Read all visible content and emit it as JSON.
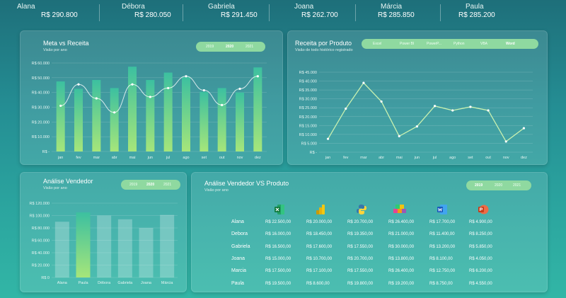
{
  "kpis": [
    {
      "name": "Alana",
      "value": "R$ 290.800"
    },
    {
      "name": "Débora",
      "value": "R$ 280.050"
    },
    {
      "name": "Gabriela",
      "value": "R$ 291.450"
    },
    {
      "name": "Joana",
      "value": "R$ 262.700"
    },
    {
      "name": "Márcia",
      "value": "R$ 285.850"
    },
    {
      "name": "Paula",
      "value": "R$ 285.200"
    }
  ],
  "meta": {
    "title": "Meta vs Receita",
    "subtitle": "Visão por ano",
    "years": [
      "2019",
      "2020",
      "2021"
    ],
    "active_year": "2020"
  },
  "receita": {
    "title": "Receita por Produto",
    "subtitle": "Visão de todo histórico registrado",
    "products": [
      "Excel",
      "Power BI",
      "PowerP...",
      "Python",
      "VBA",
      "Word"
    ],
    "active_product": "Word"
  },
  "vendedor": {
    "title": "Análise Vendedor",
    "subtitle": "Visão por ano",
    "years": [
      "2019",
      "2020",
      "2021"
    ],
    "active_year": "2020"
  },
  "vxp": {
    "title": "Análise Vendedor VS Produto",
    "subtitle": "Visão por ano",
    "years": [
      "2019",
      "2020",
      "2021"
    ],
    "active_year": "2019",
    "icons": [
      "excel-icon",
      "powerbi-icon",
      "python-icon",
      "powerpivot-icon",
      "word-icon",
      "powerpoint-icon"
    ],
    "rows": [
      {
        "name": "Alana",
        "cells": [
          "R$ 22.500,00",
          "R$ 20.000,00",
          "R$ 20.700,00",
          "R$ 26.400,00",
          "R$ 17.700,00",
          "R$ 4.900,00"
        ]
      },
      {
        "name": "Debora",
        "cells": [
          "R$ 16.000,00",
          "R$ 18.450,00",
          "R$ 19.350,00",
          "R$ 21.000,00",
          "R$ 11.400,00",
          "R$ 8.250,00"
        ]
      },
      {
        "name": "Gabriela",
        "cells": [
          "R$ 16.500,00",
          "R$ 17.600,00",
          "R$ 17.550,00",
          "R$ 30.000,00",
          "R$ 13.200,00",
          "R$ 5.850,00"
        ]
      },
      {
        "name": "Joana",
        "cells": [
          "R$ 15.000,00",
          "R$ 10.700,00",
          "R$ 20.700,00",
          "R$ 13.800,00",
          "R$ 8.100,00",
          "R$ 4.050,00"
        ]
      },
      {
        "name": "Marcia",
        "cells": [
          "R$ 17.500,00",
          "R$ 17.100,00",
          "R$ 17.550,00",
          "R$ 26.400,00",
          "R$ 12.750,00",
          "R$ 6.200,00"
        ]
      },
      {
        "name": "Paula",
        "cells": [
          "R$ 19.500,00",
          "R$ 8.600,00",
          "R$ 19.800,00",
          "R$ 19.200,00",
          "R$ 8.750,00",
          "R$ 4.550,00"
        ]
      }
    ]
  },
  "colors": {
    "bar_top": "#3cc0a0",
    "bar_bottom": "#a6e67a",
    "line": "#c9f2b0",
    "pill": "#8fd9a0"
  },
  "chart_data": [
    {
      "type": "bar",
      "categories": [
        "jan",
        "fev",
        "mar",
        "abr",
        "mai",
        "jun",
        "jul",
        "ago",
        "set",
        "out",
        "nov",
        "dez"
      ],
      "series": [
        {
          "values": [
            47500,
            42500,
            48500,
            43000,
            57500,
            48500,
            53500,
            50500,
            40500,
            43000,
            40000,
            57000
          ]
        },
        {
          "values": [
            31000,
            45500,
            36000,
            26500,
            45500,
            37000,
            43000,
            51000,
            41500,
            31500,
            42500,
            51000
          ]
        }
      ],
      "ylim": [
        0,
        60000
      ],
      "yticks": [
        "R$ -",
        "R$ 10.000",
        "R$ 20.000",
        "R$ 30.000",
        "R$ 40.000",
        "R$ 50.000",
        "R$ 60.000"
      ]
    },
    {
      "type": "line",
      "categories": [
        "jan",
        "fev",
        "mar",
        "abr",
        "mai",
        "jun",
        "jul",
        "ago",
        "set",
        "out",
        "nov",
        "dez"
      ],
      "values": [
        7500,
        24500,
        39000,
        28500,
        9000,
        14500,
        26000,
        23500,
        25500,
        23500,
        6000,
        13500
      ],
      "ylim": [
        0,
        45000
      ],
      "yticks": [
        "R$ -",
        "R$ 5.000",
        "R$ 10.000",
        "R$ 15.000",
        "R$ 20.000",
        "R$ 25.000",
        "R$ 30.000",
        "R$ 35.000",
        "R$ 40.000",
        "R$ 45.000"
      ]
    },
    {
      "type": "bar",
      "categories": [
        "Alana",
        "Paula",
        "Débora",
        "Gabriela",
        "Joana",
        "Márcia"
      ],
      "values": [
        90000,
        105000,
        100000,
        94000,
        80000,
        101000
      ],
      "highlight": "Paula",
      "ylim": [
        0,
        120000
      ],
      "yticks": [
        "R$ 0",
        "R$ 20.000",
        "R$ 40.000",
        "R$ 60.000",
        "R$ 80.000",
        "R$ 100.000",
        "R$ 120.000"
      ]
    }
  ]
}
